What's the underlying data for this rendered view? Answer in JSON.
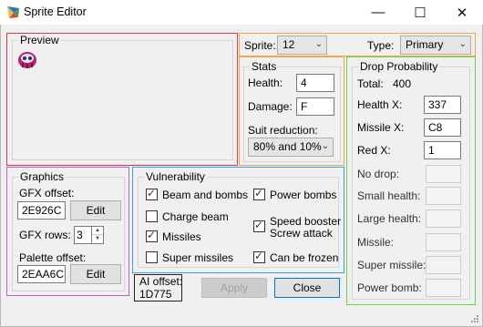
{
  "window": {
    "title": "Sprite Editor",
    "minimize": "—",
    "maximize": "☐",
    "close": "✕"
  },
  "preview": {
    "title": "Preview"
  },
  "sprite": {
    "label": "Sprite:",
    "value": "12",
    "type_label": "Type:",
    "type_value": "Primary"
  },
  "stats": {
    "title": "Stats",
    "health_label": "Health:",
    "health_value": "4",
    "damage_label": "Damage:",
    "damage_value": "F",
    "suit_label": "Suit reduction:",
    "suit_value": "80% and 10%"
  },
  "drop": {
    "title": "Drop Probability",
    "total_label": "Total:",
    "total_value": "400",
    "health_x_label": "Health X:",
    "health_x_value": "337",
    "missile_x_label": "Missile X:",
    "missile_x_value": "C8",
    "red_x_label": "Red X:",
    "red_x_value": "1",
    "rows": [
      "No drop:",
      "Small health:",
      "Large health:",
      "Missile:",
      "Super missile:",
      "Power bomb:"
    ]
  },
  "graphics": {
    "title": "Graphics",
    "gfx_offset_label": "GFX offset:",
    "gfx_offset_value": "2E926C",
    "edit1": "Edit",
    "gfx_rows_label": "GFX rows:",
    "gfx_rows_value": "3",
    "palette_label": "Palette offset:",
    "palette_value": "2EAA6C",
    "edit2": "Edit"
  },
  "vulnerability": {
    "title": "Vulnerability",
    "beam_and_bombs": "Beam and bombs",
    "charge_beam": "Charge beam",
    "missiles": "Missiles",
    "super_missiles": "Super missiles",
    "power_bombs": "Power bombs",
    "speed_booster_1": "Speed booster",
    "speed_booster_2": "Screw attack",
    "can_be_frozen": "Can be frozen"
  },
  "ai": {
    "label": "AI offset:",
    "value": "1D775"
  },
  "buttons": {
    "apply": "Apply",
    "close": "Close"
  },
  "colors": {
    "red": "#d23c4b",
    "orange": "#f0a64b",
    "green": "#6ad44a",
    "purple": "#c85bc8",
    "blue": "#3ca0d8"
  }
}
